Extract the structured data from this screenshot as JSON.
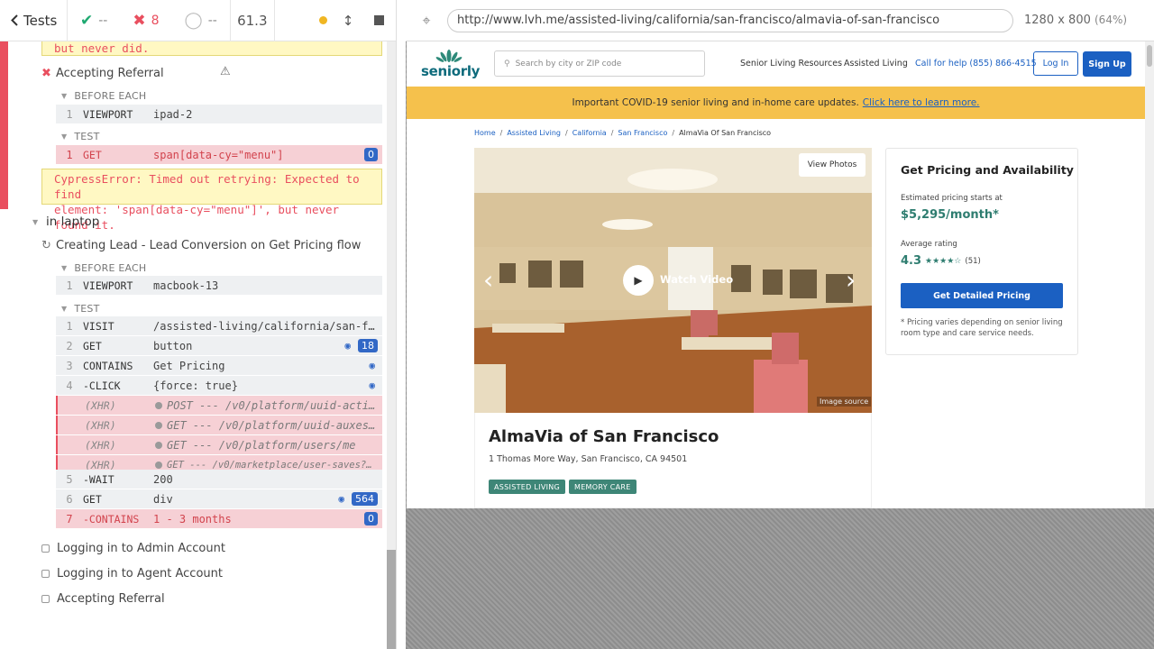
{
  "reporter": {
    "tests_label": "Tests",
    "passed": "--",
    "failed": "8",
    "pending": "--",
    "duration": "61.3",
    "prev_error_tail": "but never did.",
    "accepting_referral_title": "Accepting Referral",
    "before_each_label": "BEFORE EACH",
    "test_label": "TEST",
    "ipad_viewport": {
      "num": "1",
      "name": "VIEWPORT",
      "msg": "ipad-2"
    },
    "ipad_get": {
      "num": "1",
      "name": "GET",
      "msg": "span[data-cy=\"menu\"]",
      "badge": "0"
    },
    "cypress_error_line1": "CypressError: Timed out retrying: Expected to find",
    "cypress_error_line2": "element: 'span[data-cy=\"menu\"]', but never found it.",
    "laptop_suite": "in laptop",
    "lead_test_title": "Creating Lead - Lead Conversion on Get Pricing flow",
    "laptop_viewport": {
      "num": "1",
      "name": "VIEWPORT",
      "msg": "macbook-13"
    },
    "commands": [
      {
        "num": "1",
        "name": "VISIT",
        "msg": "/assisted-living/california/san-f..."
      },
      {
        "num": "2",
        "name": "GET",
        "msg": "button",
        "badge": "18"
      },
      {
        "num": "3",
        "name": "CONTAINS",
        "msg": "Get Pricing"
      },
      {
        "num": "4",
        "name": "-CLICK",
        "msg": "{force: true}"
      },
      {
        "num": "",
        "name": "(XHR)",
        "msg": "POST --- /v0/platform/uuid-acti..."
      },
      {
        "num": "",
        "name": "(XHR)",
        "msg": "GET --- /v0/platform/uuid-auxes..."
      },
      {
        "num": "",
        "name": "(XHR)",
        "msg": "GET --- /v0/platform/users/me"
      },
      {
        "num": "",
        "name": "(XHR)",
        "msg": "GET --- /v0/marketplace/user-saves?fi..."
      },
      {
        "num": "5",
        "name": "-WAIT",
        "msg": "200"
      },
      {
        "num": "6",
        "name": "GET",
        "msg": "div",
        "badge": "564"
      },
      {
        "num": "7",
        "name": "-CONTAINS",
        "msg": "1 - 3 months",
        "badge": "0"
      }
    ],
    "pending_tests": [
      "Logging in to Admin Account",
      "Logging in to Agent Account",
      "Accepting Referral"
    ]
  },
  "aut": {
    "url": "http://www.lvh.me/assisted-living/california/san-francisco/almavia-of-san-francisco",
    "viewport": "1280 x 800",
    "scale": "(64%)"
  },
  "site": {
    "logo": "seniorly",
    "search_placeholder": "Search by city or ZIP code",
    "nav_resources": "Senior Living Resources",
    "nav_assisted": "Assisted Living",
    "nav_phone": "Call for help (855) 866-4515",
    "login": "Log In",
    "signup": "Sign Up",
    "covid_text": "Important COVID-19 senior living and in-home care updates.",
    "covid_link": "Click here to learn more.",
    "breadcrumbs": [
      "Home",
      "Assisted Living",
      "California",
      "San Francisco",
      "AlmaVia Of San Francisco"
    ],
    "view_photos": "View Photos",
    "watch_video": "Watch Video",
    "image_source": "Image source",
    "community_name": "AlmaVia of San Francisco",
    "address": "1 Thomas More Way, San Francisco, CA 94501",
    "tags": [
      "ASSISTED LIVING",
      "MEMORY CARE"
    ],
    "pricing_title": "Get Pricing and Availability",
    "pricing_est_label": "Estimated pricing starts at",
    "pricing_value": "$5,295/month*",
    "rating_label": "Average rating",
    "rating_value": "4.3",
    "rating_stars": 4.3,
    "rating_stars_text": "★★★★☆",
    "rating_count": "(51)",
    "pricing_cta": "Get Detailed Pricing",
    "pricing_note": "* Pricing varies depending on senior living room type and care service needs."
  }
}
